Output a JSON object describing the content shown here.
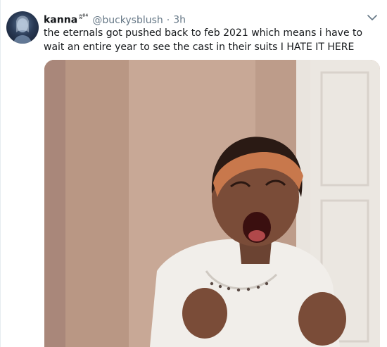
{
  "tweet": {
    "display_name": "kanna",
    "badge": "ʬ⁸⁴",
    "handle": "@buckysblush",
    "separator": "·",
    "time": "3h",
    "text": "the eternals got pushed back to feb 2021 which means i have to wait an entire year to see the cast in their suits I HATE IT HERE"
  },
  "icons": {
    "avatar": "avatar-image",
    "menu": "chevron-down-icon",
    "media": "photo"
  },
  "colors": {
    "name": "#14171a",
    "secondary": "#657786",
    "background": "#ffffff"
  }
}
